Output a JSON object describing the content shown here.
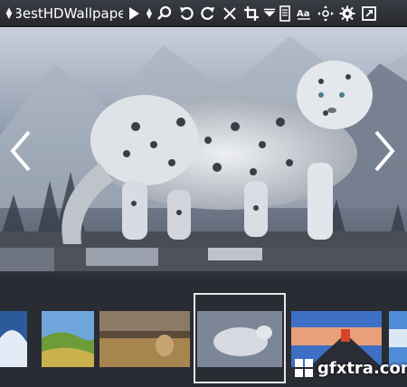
{
  "app": {
    "title": "BestHDWallpape",
    "updown_glyph": "⇕"
  },
  "toolbar": {
    "icons": [
      "play-icon",
      "spin-icon",
      "search-icon",
      "rotate-left-icon",
      "rotate-right-icon",
      "close-icon",
      "crop-icon",
      "filter-icon",
      "page-icon",
      "text-size-icon",
      "fit-icon",
      "gear-icon",
      "fullscreen-icon"
    ]
  },
  "viewer": {
    "prev_glyph": "‹",
    "next_glyph": "›"
  },
  "watermark": {
    "text": "gfxtra.com"
  },
  "colors": {
    "toolbar_bg": "#2e3036",
    "selection_border": "#e8e8e8"
  }
}
